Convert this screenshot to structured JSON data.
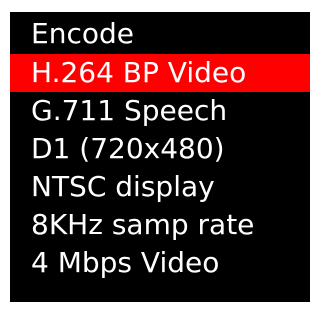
{
  "menu": {
    "title": "Encode",
    "items": [
      {
        "label": "H.264 BP Video",
        "selected": true
      },
      {
        "label": "G.711 Speech",
        "selected": false
      },
      {
        "label": "D1 (720x480)",
        "selected": false
      },
      {
        "label": "NTSC display",
        "selected": false
      },
      {
        "label": "8KHz samp rate",
        "selected": false
      },
      {
        "label": "4 Mbps Video",
        "selected": false
      }
    ]
  },
  "colors": {
    "screen_background": "#000000",
    "text": "#ffffff",
    "selection_highlight": "#ff0000"
  }
}
